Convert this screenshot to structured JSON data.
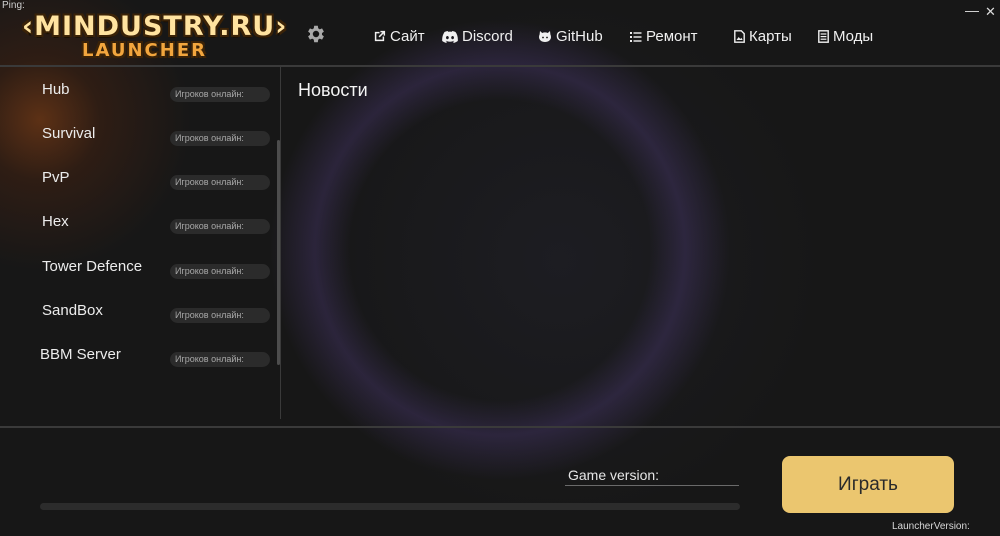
{
  "status": {
    "ping_label": "Ping:"
  },
  "logo": {
    "line1": "‹MINDUSTRY.RU›",
    "line2": "LAUNCHER"
  },
  "window": {
    "minimize": "—",
    "close": "✕"
  },
  "nav": [
    {
      "label": "Сайт",
      "icon": "external-link-icon"
    },
    {
      "label": "Discord",
      "icon": "discord-icon"
    },
    {
      "label": "GitHub",
      "icon": "github-icon"
    },
    {
      "label": "Ремонт",
      "icon": "list-icon"
    },
    {
      "label": "Карты",
      "icon": "map-file-icon"
    },
    {
      "label": "Моды",
      "icon": "document-icon"
    }
  ],
  "servers": [
    {
      "name": "Hub",
      "online_label": "Игроков онлайн:"
    },
    {
      "name": "Survival",
      "online_label": "Игроков онлайн:"
    },
    {
      "name": "PvP",
      "online_label": "Игроков онлайн:"
    },
    {
      "name": "Hex",
      "online_label": "Игроков онлайн:"
    },
    {
      "name": "Tower Defence",
      "online_label": "Игроков онлайн:"
    },
    {
      "name": "SandBox",
      "online_label": "Игроков онлайн:"
    },
    {
      "name": "BBM Server",
      "online_label": "Игроков онлайн:"
    }
  ],
  "news": {
    "title": "Новости"
  },
  "footer": {
    "game_version_label": "Game version:",
    "play_label": "Играть",
    "launcher_version_label": "LauncherVersion:",
    "progress_fraction": 0
  },
  "colors": {
    "accent": "#ebc66f",
    "background": "#171717",
    "divider": "#3a3a3a"
  }
}
